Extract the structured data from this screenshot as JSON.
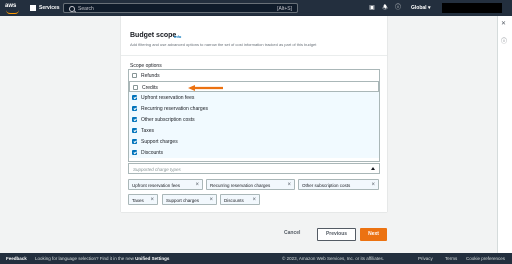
{
  "nav": {
    "logo": "aws",
    "services_label": "Services",
    "search_placeholder": "Search",
    "search_shortcut": "[Alt+S]",
    "region_label": "Global",
    "icons": [
      "cloudshell-icon",
      "bell-icon",
      "help-icon",
      "gear-icon"
    ]
  },
  "section": {
    "title": "Budget scope",
    "info_link": "Info",
    "description": "Add filtering and use advanced options to narrow the set of cost information tracked as part of this budget",
    "scope_options_label": "Scope options"
  },
  "options": [
    {
      "label": "Refunds",
      "checked": false
    },
    {
      "label": "Credits",
      "checked": false
    },
    {
      "label": "Upfront reservation fees",
      "checked": true
    },
    {
      "label": "Recurring reservation charges",
      "checked": true
    },
    {
      "label": "Other subscription costs",
      "checked": true
    },
    {
      "label": "Taxes",
      "checked": true
    },
    {
      "label": "Support charges",
      "checked": true
    },
    {
      "label": "Discounts",
      "checked": true
    }
  ],
  "dropdown": {
    "placeholder": "Supported charge types"
  },
  "tokens": [
    {
      "label": "Upfront reservation fees"
    },
    {
      "label": "Recurring reservation charges"
    },
    {
      "label": "Other subscription costs"
    },
    {
      "label": "Taxes"
    },
    {
      "label": "Support charges"
    },
    {
      "label": "Discounts"
    }
  ],
  "buttons": {
    "cancel": "Cancel",
    "previous": "Previous",
    "next": "Next"
  },
  "footer": {
    "feedback": "Feedback",
    "language_prompt": "Looking for language selection? Find it in the new",
    "unified_settings": "Unified Settings",
    "copyright": "© 2023, Amazon Web Services, Inc. or its affiliates.",
    "privacy": "Privacy",
    "terms": "Terms",
    "cookie": "Cookie preferences"
  },
  "colors": {
    "accent": "#ec7211",
    "link": "#0073bb",
    "nav_bg": "#232f3e"
  }
}
